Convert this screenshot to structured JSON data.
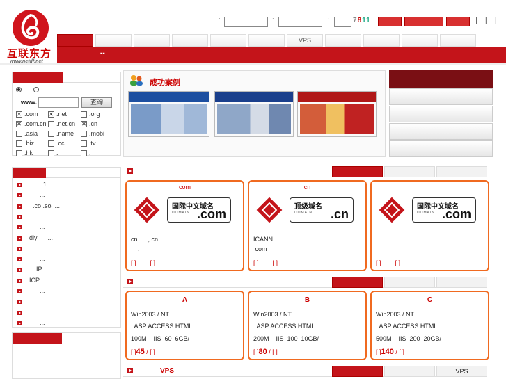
{
  "brand": {
    "name": "互联东方",
    "url": "www.netdf.net"
  },
  "login": {
    "code_1": "7",
    "code_2": "8",
    "code_3": "11",
    "bars": "| | |"
  },
  "nav": {
    "tabs": [
      "",
      "",
      "",
      "",
      "",
      "",
      "VPS",
      "",
      "",
      "",
      "",
      ""
    ],
    "sub": "--"
  },
  "domain_search": {
    "prefix": "www.",
    "query_label": "查询",
    "tlds": [
      {
        "label": ".com",
        "checked": true
      },
      {
        "label": ".net",
        "checked": true
      },
      {
        "label": ".org",
        "checked": false
      },
      {
        "label": ".com.cn",
        "checked": true
      },
      {
        "label": ".net.cn",
        "checked": false
      },
      {
        "label": ".cn",
        "checked": true
      },
      {
        "label": ".asia",
        "checked": false
      },
      {
        "label": ".name",
        "checked": false
      },
      {
        "label": ".mobi",
        "checked": false
      },
      {
        "label": ".biz",
        "checked": false
      },
      {
        "label": ".cc",
        "checked": false
      },
      {
        "label": ".tv",
        "checked": false
      },
      {
        "label": ".hk",
        "checked": false
      },
      {
        "label": ".",
        "checked": false
      },
      {
        "label": ".",
        "checked": false
      }
    ]
  },
  "showcase": {
    "title": "成功案例"
  },
  "left_list": [
    "        1...",
    "      ...",
    "  .co .so  ...",
    "      ...",
    "      ...",
    "diy      ...",
    "      ...",
    "      ...",
    "    IP    ...",
    "ICP       ...",
    "      ...",
    "      ...",
    "      ...",
    "      ..."
  ],
  "domain_cards": [
    {
      "tag": "com",
      "zh": "国际中文域名",
      "en": "DOMAIN",
      "ext": ".com",
      "l1": "cn      , cn",
      "l2": "    ,",
      "l3": "",
      "foot": "[ ]        [ ]"
    },
    {
      "tag": "cn",
      "zh": "顶级域名",
      "en": "DOMAIN",
      "ext": ".cn",
      "l1": "ICANN",
      "l2": "",
      "l3": " com",
      "foot": "[ ]        [ ]"
    },
    {
      "tag": "",
      "zh": "国际中文域名",
      "en": "DOMAIN",
      "ext": ".com",
      "l1": "",
      "l2": "",
      "l3": "",
      "foot": "[ ]        [ ]"
    }
  ],
  "host_cards": [
    {
      "tag": "A",
      "os": "Win2003 / NT",
      "tech": "  ASP ACCESS HTML",
      "spec": "100M    IIS  60  6GB/",
      "price": "45"
    },
    {
      "tag": "B",
      "os": "Win2003 / NT",
      "tech": "  ASP ACCESS HTML",
      "spec": "200M    IIS  100  10GB/",
      "price": "80"
    },
    {
      "tag": "C",
      "os": "Win2003 / NT",
      "tech": "  ASP ACCESS HTML",
      "spec": "500M    IIS  200  20GB/",
      "price": "140"
    }
  ],
  "host_foot_open": "[ ]",
  "host_foot_close": "/ [ ]",
  "vps_section": {
    "title": "VPS",
    "tab": "VPS"
  }
}
